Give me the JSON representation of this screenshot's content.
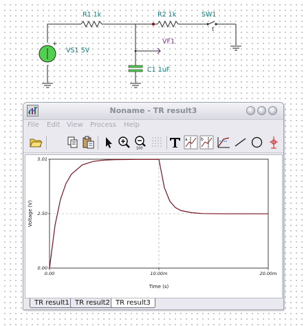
{
  "schematic": {
    "source_label": "VS1 5V",
    "resistor1_label": "R1 1k",
    "resistor2_label": "R2 1k",
    "switch_label": "SW1",
    "probe_label": "VF1",
    "capacitor_label": "C1 1uF",
    "plus_sign": "+"
  },
  "window": {
    "title": "Noname - TR result3",
    "menu": [
      "File",
      "Edit",
      "View",
      "Process",
      "Help"
    ],
    "toolbar_icons": [
      "open-folder-icon",
      "copy-icon",
      "paste-icon",
      "select-arrow-icon",
      "zoom-in-icon",
      "zoom-out-icon",
      "grid-icon",
      "text-tool-icon",
      "cursor-a-icon",
      "cursor-b-icon",
      "curve-fit-icon",
      "line-tool-icon",
      "ellipse-tool-icon",
      "marker-icon"
    ],
    "tabs": [
      "TR result1",
      "TR result2",
      "TR result3"
    ],
    "active_tab": 2
  },
  "chart_data": {
    "type": "line",
    "xlabel": "Time (s)",
    "ylabel": "Voltage (V)",
    "xlim": [
      0,
      0.02
    ],
    "ylim": [
      0,
      5.01
    ],
    "x_tick_labels": [
      "0.00",
      "10.00m",
      "20.00m"
    ],
    "y_tick_labels": [
      "0.00",
      "2.50",
      "5.01"
    ],
    "grid": "dashed at mid ticks",
    "series": [
      {
        "color": "#7a1020",
        "x": [
          0,
          0.0005,
          0.001,
          0.0015,
          0.002,
          0.003,
          0.004,
          0.005,
          0.006,
          0.008,
          0.01,
          0.0105,
          0.011,
          0.0115,
          0.012,
          0.013,
          0.014,
          0.016,
          0.018,
          0.02
        ],
        "y": [
          0,
          1.97,
          3.16,
          3.88,
          4.32,
          4.75,
          4.91,
          4.97,
          4.99,
          5.0,
          5.0,
          3.7,
          3.08,
          2.79,
          2.65,
          2.55,
          2.51,
          2.5,
          2.5,
          2.5
        ]
      }
    ]
  }
}
